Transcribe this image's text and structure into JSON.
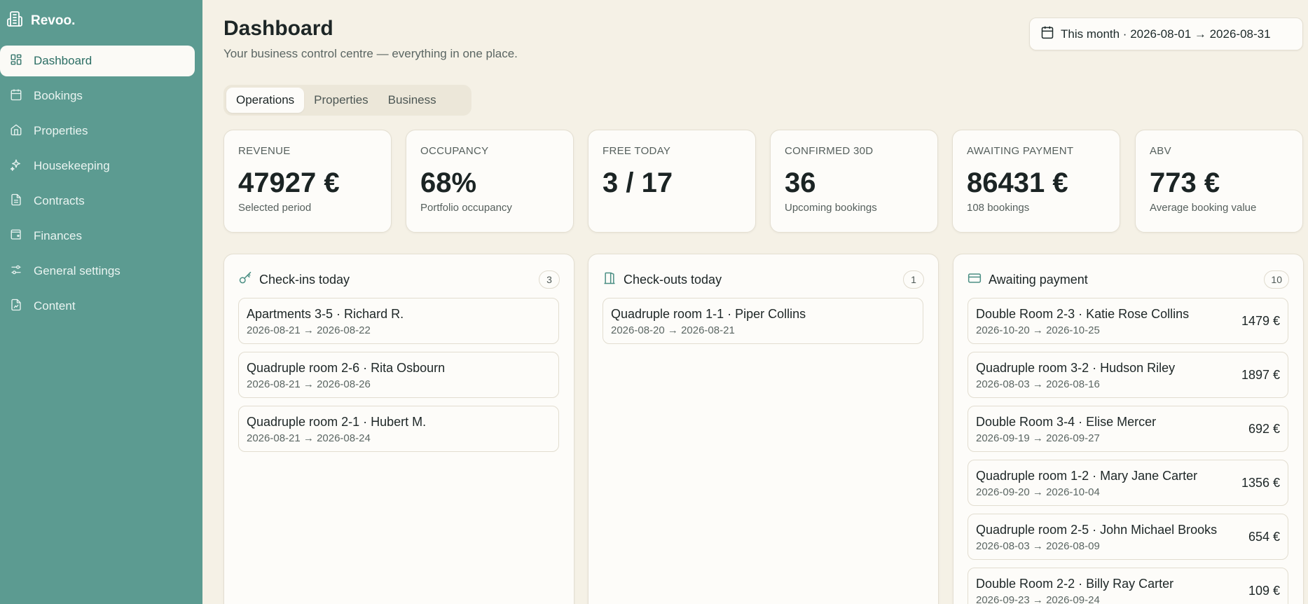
{
  "app": {
    "name": "Revoo."
  },
  "sidebar": {
    "items": [
      {
        "label": "Dashboard",
        "icon": "dashboard-icon",
        "active": true
      },
      {
        "label": "Bookings",
        "icon": "calendar-icon"
      },
      {
        "label": "Properties",
        "icon": "home-icon"
      },
      {
        "label": "Housekeeping",
        "icon": "sparkles-icon"
      },
      {
        "label": "Contracts",
        "icon": "document-icon"
      },
      {
        "label": "Finances",
        "icon": "wallet-icon"
      },
      {
        "label": "General settings",
        "icon": "sliders-icon"
      },
      {
        "label": "Content",
        "icon": "content-icon"
      }
    ]
  },
  "header": {
    "title": "Dashboard",
    "subtitle": "Your business control centre — everything in one place.",
    "date_range": "This month · 2026-08-01 → 2026-08-31"
  },
  "tabs": [
    {
      "label": "Operations",
      "active": true
    },
    {
      "label": "Properties"
    },
    {
      "label": "Business"
    }
  ],
  "kpis": [
    {
      "label": "REVENUE",
      "value": "47927 €",
      "sub": "Selected period"
    },
    {
      "label": "OCCUPANCY",
      "value": "68%",
      "sub": "Portfolio occupancy"
    },
    {
      "label": "FREE TODAY",
      "value": "3 / 17",
      "sub": ""
    },
    {
      "label": "CONFIRMED 30D",
      "value": "36",
      "sub": "Upcoming bookings"
    },
    {
      "label": "AWAITING PAYMENT",
      "value": "86431 €",
      "sub": "108 bookings"
    },
    {
      "label": "ABV",
      "value": "773 €",
      "sub": "Average booking value"
    }
  ],
  "checkins": {
    "title": "Check-ins today",
    "count": "3",
    "items": [
      {
        "title": "Apartments 3-5 · Richard R.",
        "dates": "2026-08-21 → 2026-08-22"
      },
      {
        "title": "Quadruple room 2-6 · Rita Osbourn",
        "dates": "2026-08-21 → 2026-08-26"
      },
      {
        "title": "Quadruple room 2-1 · Hubert M.",
        "dates": "2026-08-21 → 2026-08-24"
      }
    ]
  },
  "checkouts": {
    "title": "Check-outs today",
    "count": "1",
    "items": [
      {
        "title": "Quadruple room 1-1 · Piper Collins",
        "dates": "2026-08-20 → 2026-08-21"
      }
    ]
  },
  "awaiting": {
    "title": "Awaiting payment",
    "count": "10",
    "items": [
      {
        "title": "Double Room 2-3 · Katie Rose Collins",
        "dates": "2026-10-20 → 2026-10-25",
        "amount": "1479 €"
      },
      {
        "title": "Quadruple room 3-2 · Hudson Riley",
        "dates": "2026-08-03 → 2026-08-16",
        "amount": "1897 €"
      },
      {
        "title": "Double Room 3-4 · Elise Mercer",
        "dates": "2026-09-19 → 2026-09-27",
        "amount": "692 €"
      },
      {
        "title": "Quadruple room 1-2 · Mary Jane Carter",
        "dates": "2026-09-20 → 2026-10-04",
        "amount": "1356 €"
      },
      {
        "title": "Quadruple room 2-5 · John Michael Brooks",
        "dates": "2026-08-03 → 2026-08-09",
        "amount": "654 €"
      },
      {
        "title": "Double Room 2-2 · Billy Ray Carter",
        "dates": "2026-09-23 → 2026-09-24",
        "amount": "109 €"
      }
    ]
  }
}
